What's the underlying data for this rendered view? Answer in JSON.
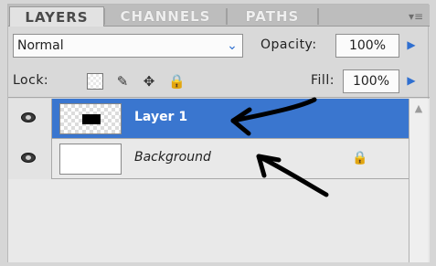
{
  "tabs": [
    {
      "label": "LAYERS"
    },
    {
      "label": "CHANNELS"
    },
    {
      "label": "PATHS"
    }
  ],
  "panel_menu_icon": "panel-menu-icon",
  "blend_mode": {
    "value": "Normal",
    "icon": "chevron-down-icon"
  },
  "opacity": {
    "label": "Opacity:",
    "value": "100%",
    "icon": "triangle-right-icon"
  },
  "lock": {
    "label": "Lock:",
    "icons": [
      "lock-transparent-icon",
      "brush-icon",
      "move-icon",
      "lock-icon"
    ]
  },
  "fill": {
    "label": "Fill:",
    "value": "100%",
    "icon": "triangle-right-icon"
  },
  "layers": [
    {
      "name": "Layer 1",
      "selected": true,
      "icon": "eye-icon"
    },
    {
      "name": "Background",
      "selected": false,
      "icon": "eye-icon",
      "locked": true
    }
  ],
  "colors": {
    "selection": "#3a76cf",
    "accent_arrow": "#2f6fd0",
    "annotation": "#000000"
  }
}
